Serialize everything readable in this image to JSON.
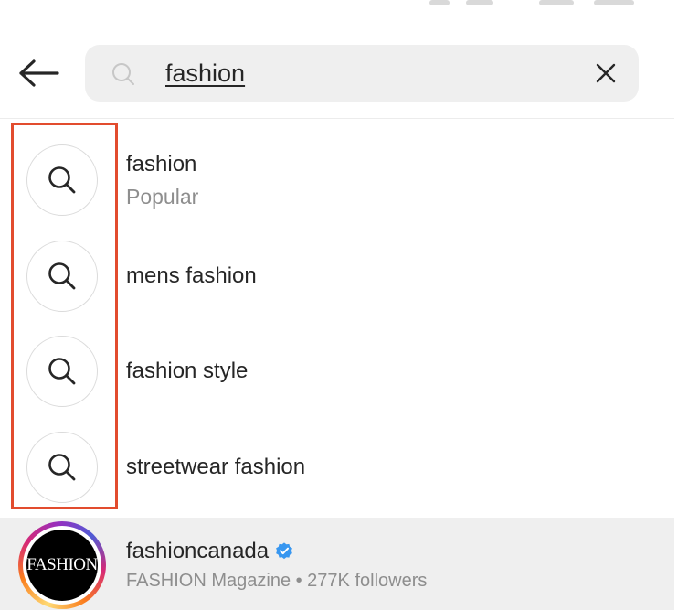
{
  "search": {
    "query": "fashion"
  },
  "suggestions": [
    {
      "title": "fashion",
      "subtitle": "Popular"
    },
    {
      "title": "mens fashion",
      "subtitle": ""
    },
    {
      "title": "fashion style",
      "subtitle": ""
    },
    {
      "title": "streetwear fashion",
      "subtitle": ""
    }
  ],
  "account": {
    "username": "fashioncanada",
    "subtitle": "FASHION Magazine • 277K followers",
    "avatar_text": "FASHION",
    "verified": true
  },
  "colors": {
    "highlight": "#e24c2e",
    "verified_badge": "#3897f0",
    "secondary_text": "#8e8e8e",
    "search_bg": "#efefef"
  },
  "icons": {
    "back": "arrow-left-icon",
    "search": "search-icon",
    "clear": "close-icon",
    "verified": "verified-badge-icon"
  }
}
